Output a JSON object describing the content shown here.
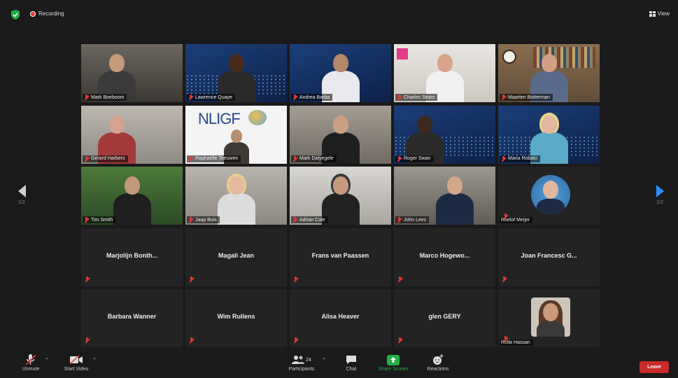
{
  "top_bar": {
    "recording_label": "Recording",
    "view_label": "View"
  },
  "nav": {
    "left_page": "1/2",
    "right_page": "1/2"
  },
  "participants": [
    {
      "name": "Mark Boeboom",
      "video": true
    },
    {
      "name": "Lawrence Quaye",
      "video": true
    },
    {
      "name": "Andrea Barba",
      "video": true
    },
    {
      "name": "Charles Sears",
      "video": true
    },
    {
      "name": "Maarten Botterman",
      "video": true
    },
    {
      "name": "Gerard Harbers",
      "video": true
    },
    {
      "name": "Raphaëlle Teeuwen",
      "video": true
    },
    {
      "name": "Mark Dalyegele",
      "video": true
    },
    {
      "name": "Roger Swan",
      "video": true
    },
    {
      "name": "Maria Robato",
      "video": true,
      "active": true
    },
    {
      "name": "Tim Smith",
      "video": true
    },
    {
      "name": "Jaap Buis",
      "video": true
    },
    {
      "name": "Adrian Cole",
      "video": true
    },
    {
      "name": "John Lees",
      "video": true
    },
    {
      "name": "Roelof Meijer",
      "video": false,
      "avatar": true
    },
    {
      "name": "Marjolijn Bonth...",
      "video": false
    },
    {
      "name": "Magali Jean",
      "video": false
    },
    {
      "name": "Frans van Paassen",
      "video": false
    },
    {
      "name": "Marco Hogewo...",
      "video": false
    },
    {
      "name": "Joan Francesc G...",
      "video": false
    },
    {
      "name": "Barbara Wanner",
      "video": false
    },
    {
      "name": "Wim Rullens",
      "video": false
    },
    {
      "name": "Alisa Heaver",
      "video": false
    },
    {
      "name": "glen GERY",
      "video": false
    },
    {
      "name": "Rolla Hassan",
      "video": false,
      "avatar": true
    }
  ],
  "nliigf_logo_text": "NLIGF",
  "toolbar": {
    "unmute": "Unmute",
    "start_video": "Start Video",
    "participants": "Participants",
    "participants_count": "24",
    "chat": "Chat",
    "share_screen": "Share Screen",
    "reactions": "Reactions",
    "leave": "Leave"
  },
  "colors": {
    "accent": "#2d8cff",
    "active_border": "#c4e34a",
    "leave": "#c92a2a",
    "share": "#23b045"
  }
}
